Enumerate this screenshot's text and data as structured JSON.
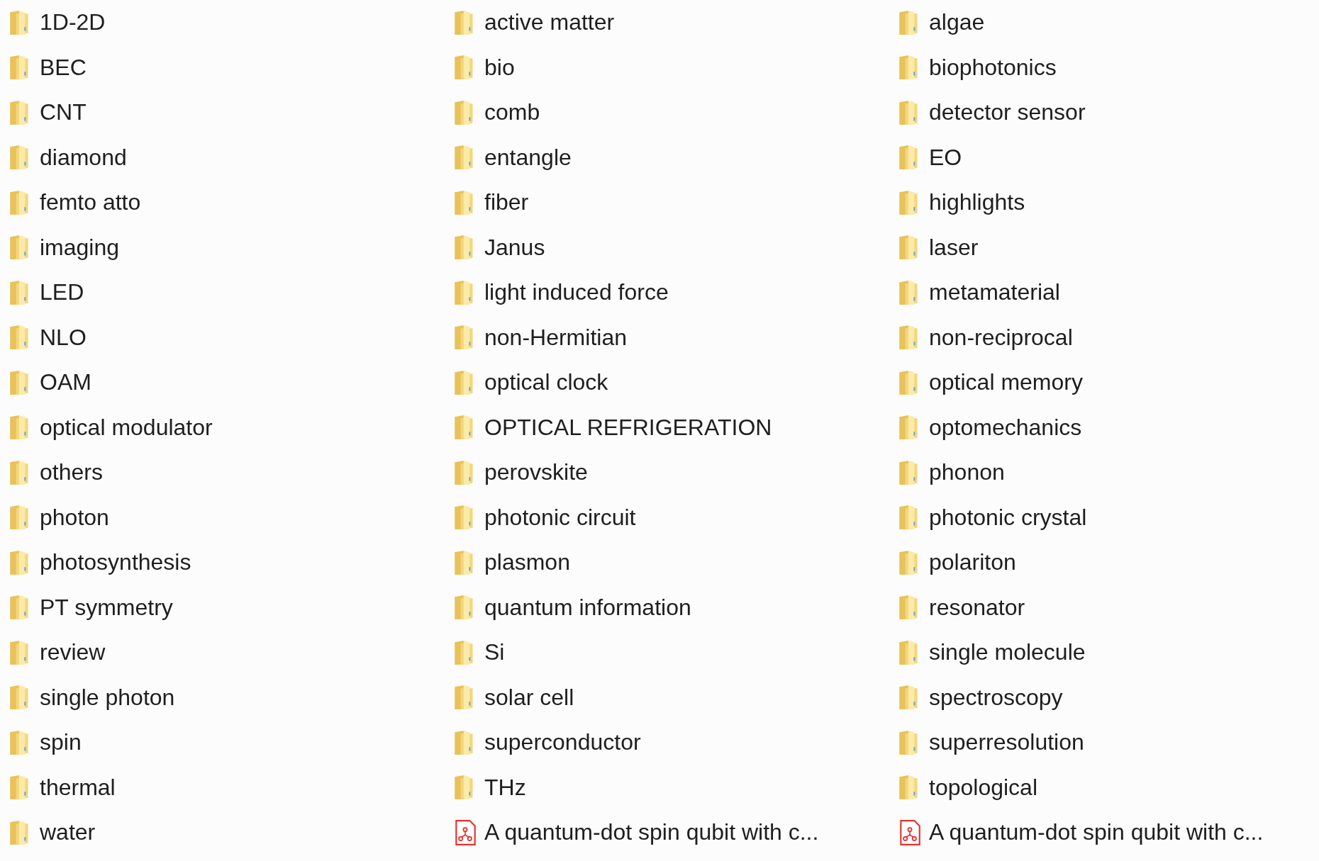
{
  "items": [
    {
      "kind": "folder",
      "name": "1D-2D"
    },
    {
      "kind": "folder",
      "name": "active matter"
    },
    {
      "kind": "folder",
      "name": "algae"
    },
    {
      "kind": "folder",
      "name": "BEC"
    },
    {
      "kind": "folder",
      "name": "bio"
    },
    {
      "kind": "folder",
      "name": "biophotonics"
    },
    {
      "kind": "folder",
      "name": "CNT"
    },
    {
      "kind": "folder",
      "name": "comb"
    },
    {
      "kind": "folder",
      "name": "detector sensor"
    },
    {
      "kind": "folder",
      "name": "diamond"
    },
    {
      "kind": "folder",
      "name": "entangle"
    },
    {
      "kind": "folder",
      "name": "EO"
    },
    {
      "kind": "folder",
      "name": "femto atto"
    },
    {
      "kind": "folder",
      "name": "fiber"
    },
    {
      "kind": "folder",
      "name": "highlights"
    },
    {
      "kind": "folder",
      "name": "imaging"
    },
    {
      "kind": "folder",
      "name": "Janus"
    },
    {
      "kind": "folder",
      "name": "laser"
    },
    {
      "kind": "folder",
      "name": "LED"
    },
    {
      "kind": "folder",
      "name": "light induced force"
    },
    {
      "kind": "folder",
      "name": "metamaterial"
    },
    {
      "kind": "folder",
      "name": "NLO"
    },
    {
      "kind": "folder",
      "name": "non-Hermitian"
    },
    {
      "kind": "folder",
      "name": "non-reciprocal"
    },
    {
      "kind": "folder",
      "name": "OAM"
    },
    {
      "kind": "folder",
      "name": "optical clock"
    },
    {
      "kind": "folder",
      "name": "optical memory"
    },
    {
      "kind": "folder",
      "name": "optical modulator"
    },
    {
      "kind": "folder",
      "name": "OPTICAL REFRIGERATION"
    },
    {
      "kind": "folder",
      "name": "optomechanics"
    },
    {
      "kind": "folder",
      "name": "others"
    },
    {
      "kind": "folder",
      "name": "perovskite"
    },
    {
      "kind": "folder",
      "name": "phonon"
    },
    {
      "kind": "folder",
      "name": "photon"
    },
    {
      "kind": "folder",
      "name": "photonic circuit"
    },
    {
      "kind": "folder",
      "name": "photonic crystal"
    },
    {
      "kind": "folder",
      "name": "photosynthesis"
    },
    {
      "kind": "folder",
      "name": "plasmon"
    },
    {
      "kind": "folder",
      "name": "polariton"
    },
    {
      "kind": "folder",
      "name": "PT symmetry"
    },
    {
      "kind": "folder",
      "name": "quantum information"
    },
    {
      "kind": "folder",
      "name": "resonator"
    },
    {
      "kind": "folder",
      "name": "review"
    },
    {
      "kind": "folder",
      "name": "Si"
    },
    {
      "kind": "folder",
      "name": "single molecule"
    },
    {
      "kind": "folder",
      "name": "single photon"
    },
    {
      "kind": "folder",
      "name": "solar cell"
    },
    {
      "kind": "folder",
      "name": "spectroscopy"
    },
    {
      "kind": "folder",
      "name": "spin"
    },
    {
      "kind": "folder",
      "name": "superconductor"
    },
    {
      "kind": "folder",
      "name": "superresolution"
    },
    {
      "kind": "folder",
      "name": "thermal"
    },
    {
      "kind": "folder",
      "name": "THz"
    },
    {
      "kind": "folder",
      "name": "topological"
    },
    {
      "kind": "folder",
      "name": "water"
    },
    {
      "kind": "pdf",
      "name": "A quantum-dot spin qubit with c..."
    },
    {
      "kind": "pdf",
      "name": "A quantum-dot spin qubit with c..."
    }
  ]
}
